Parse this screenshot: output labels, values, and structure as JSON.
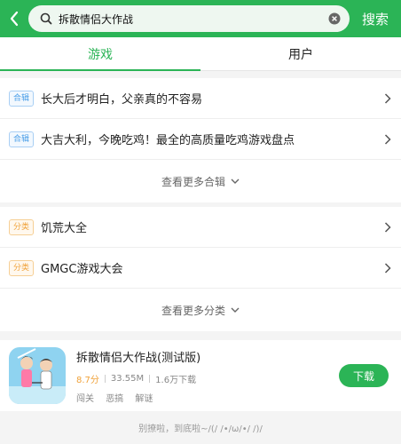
{
  "header": {
    "search_value": "拆散情侣大作战",
    "search_button": "搜索",
    "bg_color": "#2bb456",
    "icons": [
      "back-arrow-icon",
      "search-icon",
      "clear-icon"
    ]
  },
  "tabs": [
    {
      "label": "游戏",
      "active": true
    },
    {
      "label": "用户",
      "active": false
    }
  ],
  "collections": {
    "tag": "合辑",
    "items": [
      {
        "title": "长大后才明白，父亲真的不容易"
      },
      {
        "title": "大吉大利，今晚吃鸡！最全的高质量吃鸡游戏盘点"
      }
    ],
    "more": "查看更多合辑"
  },
  "categories": {
    "tag": "分类",
    "items": [
      {
        "title": "饥荒大全"
      },
      {
        "title": "GMGC游戏大会"
      }
    ],
    "more": "查看更多分类"
  },
  "app": {
    "name": "拆散情侣大作战(测试版)",
    "score": "8.7分",
    "size": "33.55M",
    "downloads": "1.6万下载",
    "tags": [
      "闯关",
      "恶搞",
      "解谜"
    ],
    "download_label": "下载"
  },
  "footer": "别撩啦，到底啦~/(/ /•/ω/•/ /)/"
}
